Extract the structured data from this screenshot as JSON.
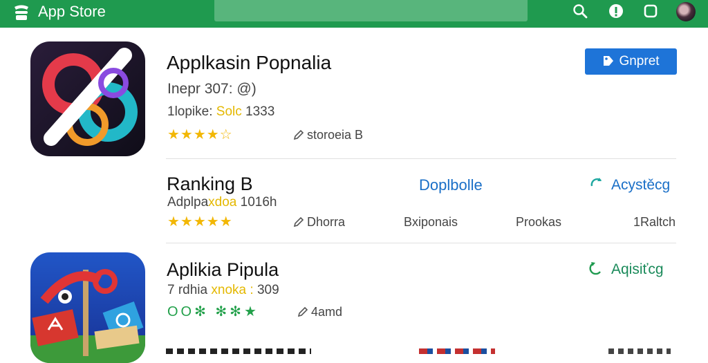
{
  "topbar": {
    "brand": "App Store",
    "icons": [
      "store-logo-icon",
      "search-icon",
      "info-icon",
      "window-icon",
      "avatar"
    ]
  },
  "apps": [
    {
      "title": "Applkasin Popnalia",
      "line1": "Inepr 307: @)",
      "line2_prefix": "1lopike:",
      "line2_highlight": "Solc",
      "line2_suffix": "1333",
      "stars": "★★★★☆",
      "meta": "storoeia B",
      "button": "Gnpret"
    },
    {
      "title": "Ranking B",
      "line1_prefix": "Adplpa",
      "line1_highlight": "xdoa",
      "line1_suffix": "1016h",
      "stars": "★★★★★",
      "link": "Doplbolle",
      "action": "Acystěcg",
      "meta": [
        "Dhorra",
        "Bxiponais",
        "Prookas",
        "1Raltch"
      ]
    },
    {
      "title": "Aplikia Pipula",
      "line1_prefix": "7 rdhia",
      "line1_highlight": "xnoka :",
      "line1_suffix": "309",
      "symbols": "OO✻ ✻✻★",
      "meta": "4amd",
      "action": "Aqisiťcg"
    }
  ],
  "colors": {
    "topbar": "#1f9a4f",
    "primary_button": "#1e74d8",
    "star": "#f2b705",
    "link": "#1a6fc7",
    "action": "#1f9a4f"
  }
}
